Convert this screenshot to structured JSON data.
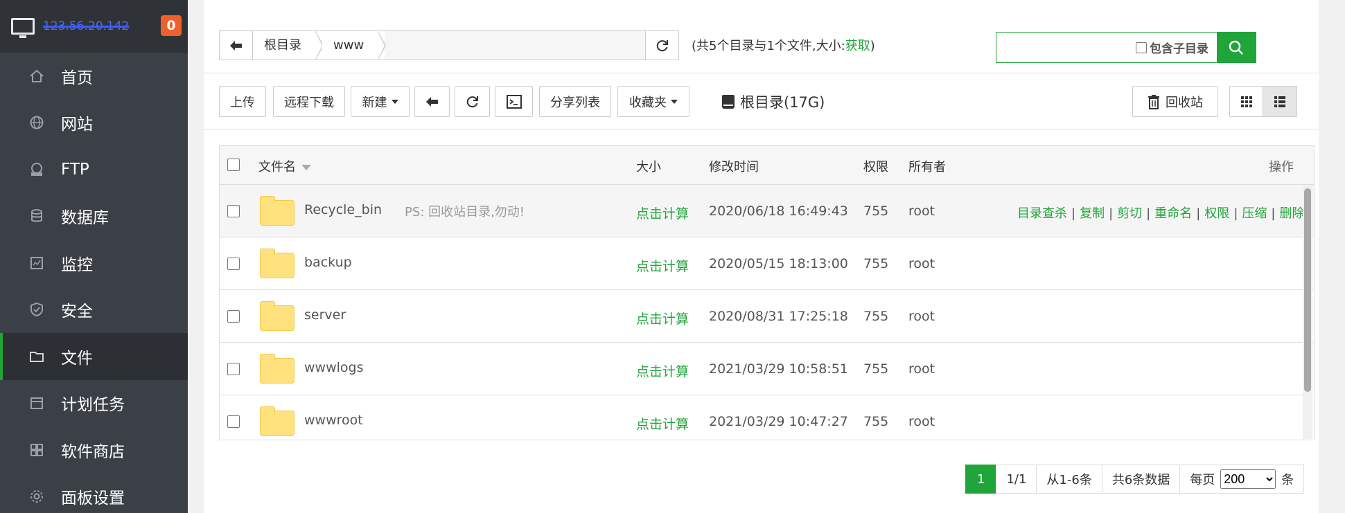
{
  "sidebar": {
    "ip": "123.56.20.142",
    "badge": "0",
    "items": [
      {
        "label": "首页",
        "icon": "home-icon"
      },
      {
        "label": "网站",
        "icon": "globe-icon"
      },
      {
        "label": "FTP",
        "icon": "ftp-icon"
      },
      {
        "label": "数据库",
        "icon": "database-icon"
      },
      {
        "label": "监控",
        "icon": "monitor-icon"
      },
      {
        "label": "安全",
        "icon": "shield-icon"
      },
      {
        "label": "文件",
        "icon": "folder-icon",
        "active": true
      },
      {
        "label": "计划任务",
        "icon": "calendar-icon"
      },
      {
        "label": "软件商店",
        "icon": "apps-icon"
      },
      {
        "label": "面板设置",
        "icon": "gear-icon"
      }
    ]
  },
  "path": {
    "crumbs": [
      "根目录",
      "www"
    ]
  },
  "summary": {
    "prefix": "(共5个目录与1个文件,大小:",
    "link": "获取",
    "suffix": ")"
  },
  "search": {
    "placeholder": "",
    "subdir_label": "包含子目录"
  },
  "toolbar": {
    "upload": "上传",
    "remote_download": "远程下载",
    "new": "新建",
    "share_list": "分享列表",
    "favorites": "收藏夹",
    "disk": "根目录(17G)",
    "recycle": "回收站"
  },
  "table": {
    "headers": {
      "name": "文件名",
      "size": "大小",
      "mtime": "修改时间",
      "perm": "权限",
      "owner": "所有者",
      "ops": "操作"
    },
    "rows": [
      {
        "name": "Recycle_bin",
        "note": "PS: 回收站目录,勿动!",
        "size": "点击计算",
        "mtime": "2020/06/18 16:49:43",
        "perm": "755",
        "owner": "root",
        "highlight": true
      },
      {
        "name": "backup",
        "note": "",
        "size": "点击计算",
        "mtime": "2020/05/15 18:13:00",
        "perm": "755",
        "owner": "root"
      },
      {
        "name": "server",
        "note": "",
        "size": "点击计算",
        "mtime": "2020/08/31 17:25:18",
        "perm": "755",
        "owner": "root"
      },
      {
        "name": "wwwlogs",
        "note": "",
        "size": "点击计算",
        "mtime": "2021/03/29 10:58:51",
        "perm": "755",
        "owner": "root"
      },
      {
        "name": "wwwroot",
        "note": "",
        "size": "点击计算",
        "mtime": "2021/03/29 10:47:27",
        "perm": "755",
        "owner": "root"
      }
    ],
    "ops": [
      "目录查杀",
      "复制",
      "剪切",
      "重命名",
      "权限",
      "压缩",
      "删除"
    ]
  },
  "pager": {
    "current": "1",
    "pages": "1/1",
    "range": "从1-6条",
    "total": "共6条数据",
    "per_page_label": "每页",
    "per_page": "200",
    "unit": "条"
  },
  "colors": {
    "accent": "#20a53a",
    "sidebar_bg": "#3b4046",
    "badge": "#f0602b"
  }
}
